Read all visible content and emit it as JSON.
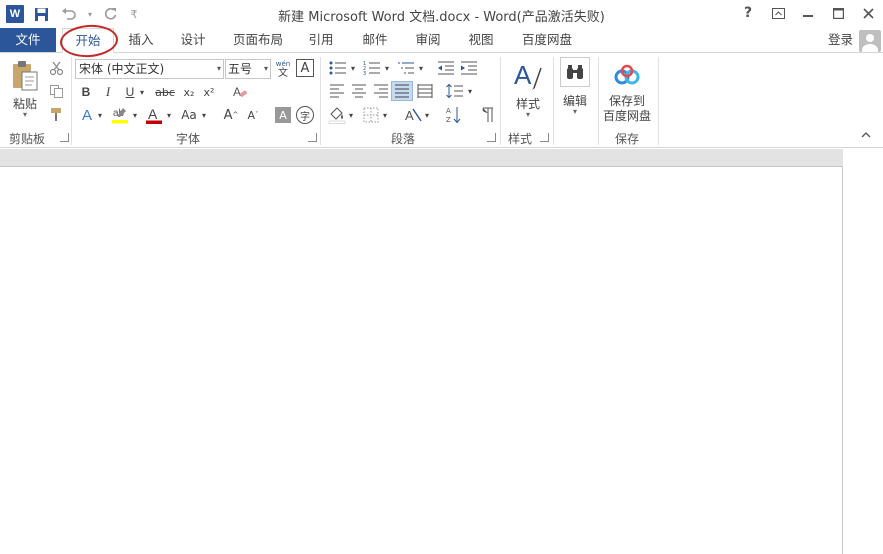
{
  "window": {
    "title": "新建 Microsoft Word 文档.docx - Word(产品激活失败)",
    "help": "?",
    "logo_letter": "W"
  },
  "quick_access": {
    "customize": "₹"
  },
  "tabs": [
    {
      "label": "文件"
    },
    {
      "label": "开始"
    },
    {
      "label": "插入"
    },
    {
      "label": "设计"
    },
    {
      "label": "页面布局"
    },
    {
      "label": "引用"
    },
    {
      "label": "邮件"
    },
    {
      "label": "审阅"
    },
    {
      "label": "视图"
    },
    {
      "label": "百度网盘"
    }
  ],
  "account": {
    "login": "登录"
  },
  "ribbon": {
    "clipboard": {
      "label": "剪贴板",
      "paste": "粘贴"
    },
    "font": {
      "label": "字体",
      "font_name": "宋体 (中文正文)",
      "font_size": "五号",
      "bold": "B",
      "italic": "I",
      "underline": "U",
      "strike": "abc",
      "sub": "x₂",
      "sup": "x²",
      "text_effect": "A",
      "font_color": "A",
      "case": "Aa",
      "grow": "A",
      "shrink": "A",
      "char_shade": "A",
      "enclose": "字",
      "phonetic": "wén",
      "phonetic_char": "文",
      "border_char": "A"
    },
    "paragraph": {
      "label": "段落"
    },
    "styles": {
      "label": "样式",
      "button": "样式"
    },
    "editing": {
      "button": "编辑"
    },
    "save": {
      "label": "保存",
      "button_line1": "保存到",
      "button_line2": "百度网盘"
    }
  },
  "colors": {
    "accent": "#2b579a",
    "circle": "#c62828",
    "highlight": "#ffff00",
    "font_color": "#c00000"
  }
}
